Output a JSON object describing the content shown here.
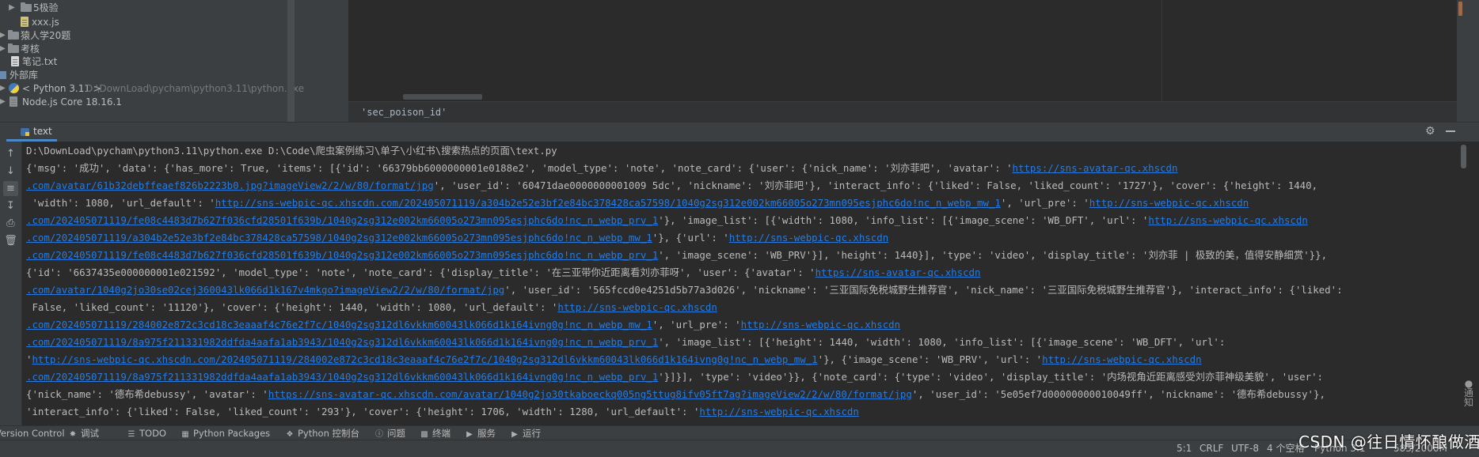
{
  "project_tree": {
    "items": [
      {
        "label": "5极验",
        "kind": "folder",
        "expandable": true
      },
      {
        "label": "xxx.js",
        "kind": "js"
      },
      {
        "label": "猿人学20题",
        "kind": "folder",
        "expandable": true
      },
      {
        "label": "考核",
        "kind": "folder",
        "expandable": true
      },
      {
        "label": "笔记.txt",
        "kind": "txt"
      },
      {
        "label": "外部库",
        "kind": "library",
        "expandable": true
      },
      {
        "label": "< Python 3.11 >",
        "path": "D:\\DownLoad\\pycham\\python3.11\\python.exe",
        "kind": "sdk",
        "expandable": true
      },
      {
        "label": "Node.js Core 18.16.1",
        "kind": "node",
        "expandable": true
      }
    ]
  },
  "editor": {
    "breadcrumb": "'sec_poison_id'"
  },
  "run_window": {
    "tab_label": "text",
    "toolbar": [
      "up-arrow-icon",
      "down-arrow-icon",
      "soft-wrap-icon",
      "scroll-to-end-icon",
      "print-icon",
      "trash-icon"
    ]
  },
  "console": {
    "lines": [
      [
        {
          "t": "D:\\DownLoad\\pycham\\python3.11\\python.exe D:\\Code\\爬虫案例练习\\单子\\小红书\\搜索热点的页面\\text.py"
        }
      ],
      [
        {
          "t": "{'msg': '成功', 'data': {'has_more': True, 'items': [{'id': '66379bb6000000001e0188e2', 'model_type': 'note', 'note_card': {'user': {'nick_name': '刘亦菲吧', 'avatar': '"
        },
        {
          "t": "https://sns-avatar-qc.xhscdn",
          "link": true
        }
      ],
      [
        {
          "t": ".com/avatar/61b32debffeaef826b2223b0.jpg?imageView2/2/w/80/format/jpg",
          "link": true
        },
        {
          "t": "', 'user_id': '60471dae0000000001009 5dc', 'nickname': '刘亦菲吧'}, 'interact_info': {'liked': False, 'liked_count': '1727'}, 'cover': {'height': 1440,"
        }
      ],
      [
        {
          "t": " 'width': 1080, 'url_default': '"
        },
        {
          "t": "http://sns-webpic-qc.xhscdn.com/202405071119/a304b2e52e3bf2e84bc378428ca57598/1040g2sg312e002km66005o273mn095esjphc6do!nc_n_webp_mw_1",
          "link": true
        },
        {
          "t": "', 'url_pre': '"
        },
        {
          "t": "http://sns-webpic-qc.xhscdn",
          "link": true
        }
      ],
      [
        {
          "t": ".com/202405071119/fe08c4483d7b627f036cfd28501f639b/1040g2sg312e002km66005o273mn095esjphc6do!nc_n_webp_prv_1",
          "link": true
        },
        {
          "t": "'}, 'image_list': [{'width': 1080, 'info_list': [{'image_scene': 'WB_DFT', 'url': '"
        },
        {
          "t": "http://sns-webpic-qc.xhscdn",
          "link": true
        }
      ],
      [
        {
          "t": ".com/202405071119/a304b2e52e3bf2e84bc378428ca57598/1040g2sg312e002km66005o273mn095esjphc6do!nc_n_webp_mw_1",
          "link": true
        },
        {
          "t": "'}, {'url': '"
        },
        {
          "t": "http://sns-webpic-qc.xhscdn",
          "link": true
        }
      ],
      [
        {
          "t": ".com/202405071119/fe08c4483d7b627f036cfd28501f639b/1040g2sg312e002km66005o273mn095esjphc6do!nc_n_webp_prv_1",
          "link": true
        },
        {
          "t": "', 'image_scene': 'WB_PRV'}], 'height': 1440}], 'type': 'video', 'display_title': '刘亦菲 | 极致的美，值得安静细赏'}},"
        }
      ],
      [
        {
          "t": "{'id': '6637435e000000001e021592', 'model_type': 'note', 'note_card': {'display_title': '在三亚带你近距离看刘亦菲呀', 'user': {'avatar': '"
        },
        {
          "t": "https://sns-avatar-qc.xhscdn",
          "link": true
        }
      ],
      [
        {
          "t": ".com/avatar/1040g2jo30se02cej360043lk066d1k167v4mkgo?imageView2/2/w/80/format/jpg",
          "link": true
        },
        {
          "t": "', 'user_id': '565fccd0e4251d5b77a3d026', 'nickname': '三亚国际免税城野生推荐官', 'nick_name': '三亚国际免税城野生推荐官'}, 'interact_info': {'liked':"
        }
      ],
      [
        {
          "t": " False, 'liked_count': '11120'}, 'cover': {'height': 1440, 'width': 1080, 'url_default': '"
        },
        {
          "t": "http://sns-webpic-qc.xhscdn",
          "link": true
        }
      ],
      [
        {
          "t": ".com/202405071119/284002e872c3cd18c3eaaaf4c76e2f7c/1040g2sg312dl6vkkm60043lk066d1k164ivng0g!nc_n_webp_mw_1",
          "link": true
        },
        {
          "t": "', 'url_pre': '"
        },
        {
          "t": "http://sns-webpic-qc.xhscdn",
          "link": true
        }
      ],
      [
        {
          "t": ".com/202405071119/8a975f211331982ddfda4aafa1ab3943/1040g2sg312dl6vkkm60043lk066d1k164ivng0g!nc_n_webp_prv_1",
          "link": true
        },
        {
          "t": "', 'image_list': [{'height': 1440, 'width': 1080, 'info_list': [{'image_scene': 'WB_DFT', 'url':"
        }
      ],
      [
        {
          "t": "'"
        },
        {
          "t": "http://sns-webpic-qc.xhscdn.com/202405071119/284002e872c3cd18c3eaaaf4c76e2f7c/1040g2sg312dl6vkkm60043lk066d1k164ivng0g!nc_n_webp_mw_1",
          "link": true
        },
        {
          "t": "'}, {'image_scene': 'WB_PRV', 'url': '"
        },
        {
          "t": "http://sns-webpic-qc.xhscdn",
          "link": true
        }
      ],
      [
        {
          "t": ".com/202405071119/8a975f211331982ddfda4aafa1ab3943/1040g2sg312dl6vkkm60043lk066d1k164ivng0g!nc_n_webp_prv_1",
          "link": true
        },
        {
          "t": "'}]}], 'type': 'video'}}, {'note_card': {'type': 'video', 'display_title': '内场视角近距离感受刘亦菲神级美貌', 'user':"
        }
      ],
      [
        {
          "t": "{'nick_name': '德布希debussy', 'avatar': '"
        },
        {
          "t": "https://sns-avatar-qc.xhscdn.com/avatar/1040g2jo30tkaboeckq005ng5ttug8ifv05ft7ag?imageView2/2/w/80/format/jpg",
          "link": true
        },
        {
          "t": "', 'user_id': '5e05ef7d00000000010049ff', 'nickname': '德布希debussy'},"
        }
      ],
      [
        {
          "t": "'interact_info': {'liked': False, 'liked_count': '293'}, 'cover': {'height': 1706, 'width': 1280, 'url_default': '"
        },
        {
          "t": "http://sns-webpic-qc.xhscdn",
          "link": true
        }
      ]
    ]
  },
  "bottom_tabs": [
    {
      "label": "Version Control",
      "icon": ""
    },
    {
      "label": "调试",
      "icon": "debug-icon"
    },
    {
      "label": "TODO",
      "icon": "todo-icon"
    },
    {
      "label": "Python Packages",
      "icon": "packages-icon"
    },
    {
      "label": "Python 控制台",
      "icon": "python-console-icon"
    },
    {
      "label": "问题",
      "icon": "problems-icon"
    },
    {
      "label": "终端",
      "icon": "terminal-icon"
    },
    {
      "label": "服务",
      "icon": "services-icon"
    },
    {
      "label": "运行",
      "icon": "run-icon"
    }
  ],
  "status_bar": {
    "position": "5:1",
    "line_ending": "CRLF",
    "encoding": "UTF-8",
    "indent": "4 个空格",
    "interpreter": "Python 3.1",
    "memory": "583/2000M"
  },
  "watermark": "CSDN @往日情怀酿做酒"
}
